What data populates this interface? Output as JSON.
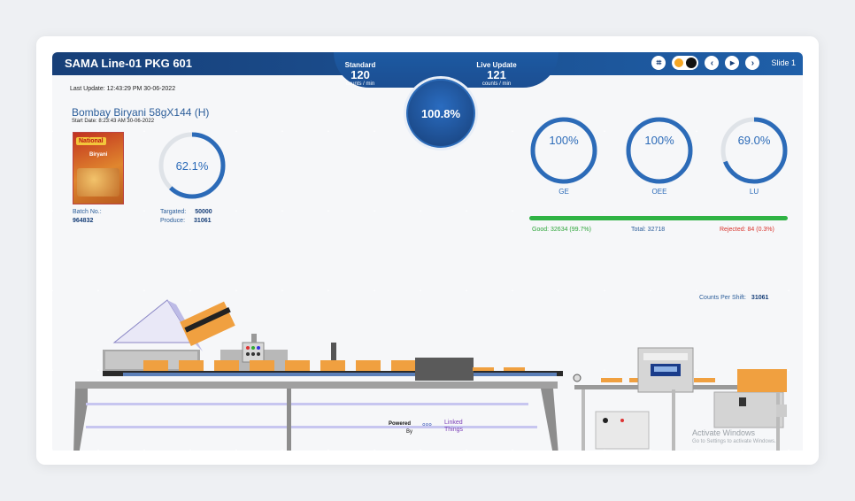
{
  "header": {
    "title": "SAMA Line-01 PKG 601",
    "standard": {
      "label": "Standard",
      "value": "120",
      "unit": "counts / min"
    },
    "live_update": {
      "label": "Live Update",
      "value": "121",
      "unit": "counts / min"
    },
    "efficiency": "100.8%",
    "slide_label": "Slide 1"
  },
  "info": {
    "last_update": "Last Update: 12:43:29 PM 30-06-2022",
    "product_name": "Bombay Biryani 58gX144 (H)",
    "start_date": "Start Date: 8:23:43 AM 30-06-2022",
    "package_brand": "National",
    "package_name": "Biryani",
    "progress_text": "62.1%",
    "progress_value": 0.621,
    "batch_label": "Batch No.:",
    "batch_value": "964832",
    "targeted_label": "Targated:",
    "targeted_value": "50000",
    "produce_label": "Produce:",
    "produce_value": "31061"
  },
  "kpis": [
    {
      "label": "GE",
      "text": "100%",
      "value": 1.0
    },
    {
      "label": "OEE",
      "text": "100%",
      "value": 1.0
    },
    {
      "label": "LU",
      "text": "69.0%",
      "value": 0.69
    }
  ],
  "quality": {
    "good": "Good: 32634 (99.7%)",
    "total": "Total: 32718",
    "rejected": "Rejected: 84 (0.3%)",
    "good_color": "#2fb344",
    "rejected_color": "#d9332b"
  },
  "counts_per_shift": {
    "label": "Counts Per Shift:",
    "value": "31061"
  },
  "footer": {
    "powered": "Powered",
    "by": "By",
    "logo_line1": "Linked",
    "logo_line2": "Things",
    "activate_windows": "Activate Windows",
    "activate_hint": "Go to Settings to activate Windows."
  },
  "colors": {
    "primary": "#173f78",
    "accent": "#2c6bb8",
    "ring_track": "#dfe3e8"
  }
}
